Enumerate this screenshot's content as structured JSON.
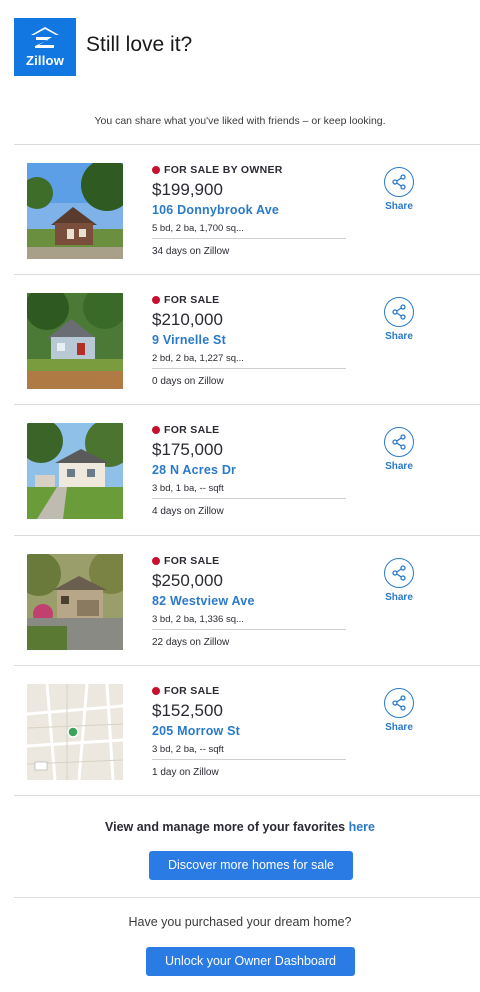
{
  "header": {
    "logo_text": "Zillow",
    "title": "Still love it?",
    "brand_color": "#1277e1"
  },
  "subtitle": "You can share what you've liked with friends – or keep looking.",
  "listings": [
    {
      "status": "FOR SALE BY OWNER",
      "price": "$199,900",
      "address": "106 Donnybrook Ave",
      "details": "5 bd, 2 ba, 1,700 sq...",
      "days": "34 days on Zillow",
      "share_label": "Share",
      "image": "house-photo"
    },
    {
      "status": "FOR SALE",
      "price": "$210,000",
      "address": "9 Virnelle St",
      "details": "2 bd, 2 ba, 1,227 sq...",
      "days": "0 days on Zillow",
      "share_label": "Share",
      "image": "house-photo"
    },
    {
      "status": "FOR SALE",
      "price": "$175,000",
      "address": "28 N Acres Dr",
      "details": "3 bd, 1 ba, -- sqft",
      "days": "4 days on Zillow",
      "share_label": "Share",
      "image": "house-photo"
    },
    {
      "status": "FOR SALE",
      "price": "$250,000",
      "address": "82 Westview Ave",
      "details": "3 bd, 2 ba, 1,336 sq...",
      "days": "22 days on Zillow",
      "share_label": "Share",
      "image": "house-photo"
    },
    {
      "status": "FOR SALE",
      "price": "$152,500",
      "address": "205 Morrow St",
      "details": "3 bd, 2 ba, -- sqft",
      "days": "1 day on Zillow",
      "share_label": "Share",
      "image": "map-thumbnail"
    }
  ],
  "manage": {
    "text": "View and manage more of your favorites ",
    "link": "here"
  },
  "discover_button": "Discover more homes for sale",
  "question": "Have you purchased your dream home?",
  "dashboard_button": "Unlock your Owner Dashboard",
  "colors": {
    "status_dot": "#c8102e",
    "link": "#2a7ac9",
    "button": "#2a7be4"
  }
}
